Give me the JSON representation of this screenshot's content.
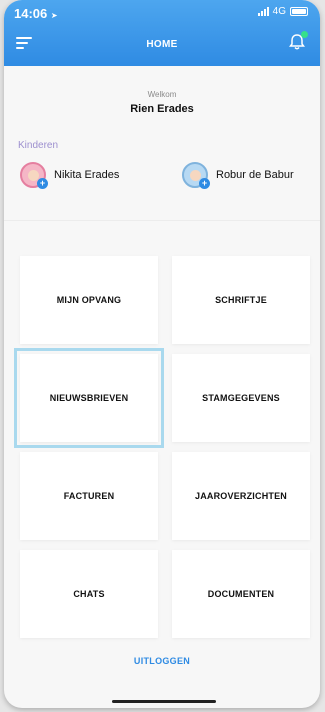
{
  "status_bar": {
    "time": "14:06",
    "network": "4G"
  },
  "header": {
    "title": "HOME"
  },
  "welcome": {
    "greeting": "Welkom",
    "name": "Rien Erades"
  },
  "kinderen": {
    "label": "Kinderen",
    "children": [
      {
        "name": "Nikita Erades"
      },
      {
        "name": "Robur de Babur"
      }
    ]
  },
  "tiles": [
    {
      "label": "MIJN OPVANG"
    },
    {
      "label": "SCHRIFTJE"
    },
    {
      "label": "NIEUWSBRIEVEN"
    },
    {
      "label": "STAMGEGEVENS"
    },
    {
      "label": "FACTUREN"
    },
    {
      "label": "JAAROVERZICHTEN"
    },
    {
      "label": "CHATS"
    },
    {
      "label": "DOCUMENTEN"
    }
  ],
  "footer": {
    "logout_label": "UITLOGGEN"
  },
  "colors": {
    "accent": "#2f8be3",
    "notification": "#35e08a",
    "kinderen_label": "#9d8fcf",
    "highlight": "#a9d9ee"
  },
  "icons": [
    "menu-icon",
    "bell-icon",
    "location-arrow-icon",
    "signal-icon",
    "battery-icon"
  ]
}
